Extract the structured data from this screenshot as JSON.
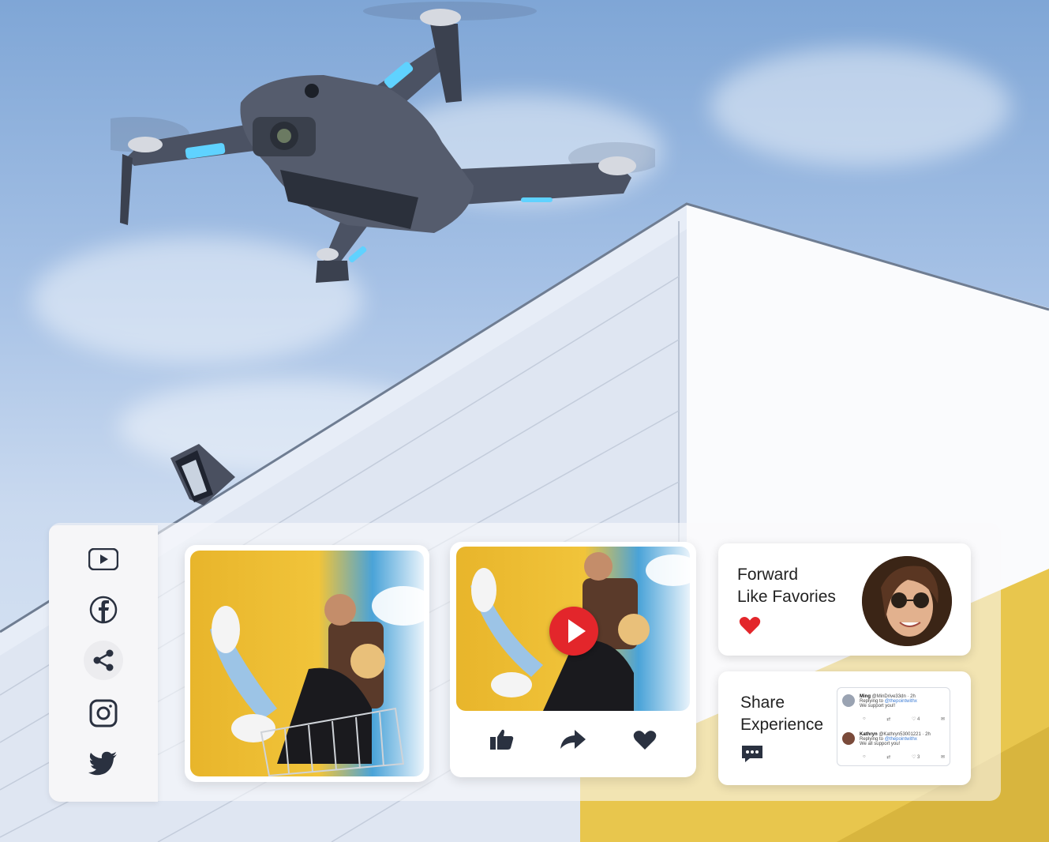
{
  "social_icons": [
    "youtube-icon",
    "facebook-icon",
    "share-icon",
    "instagram-icon",
    "twitter-icon"
  ],
  "forward_card": {
    "line1": "Forward",
    "line2": "Like Favories"
  },
  "share_card": {
    "line1": "Share",
    "line2": "Experience"
  },
  "tweets": [
    {
      "name": "Ming",
      "handle": "@MinDrive33dn · 2h",
      "reply_prefix": "Replying to",
      "reply_to": "@thepointwithx",
      "text": "We support you!!",
      "likes": "4"
    },
    {
      "name": "Kathryn",
      "handle": "@Kathryn53001221 · 2h",
      "reply_prefix": "Replying to",
      "reply_to": "@thepointwithx",
      "text": "We all support you!",
      "likes": "3"
    }
  ],
  "colors": {
    "accent_red": "#e3262b",
    "icon_dark": "#2a3140",
    "sky_top": "#7fa6d6",
    "drone_light": "#5fd2ff"
  }
}
